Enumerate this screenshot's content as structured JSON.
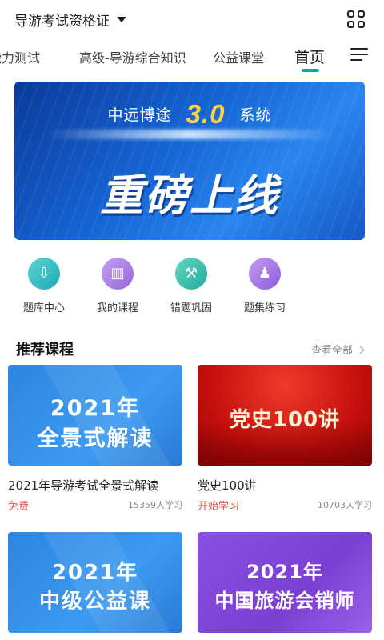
{
  "header": {
    "certificate": "导游考试资格证",
    "grid_icon": "grid-apps-icon",
    "caret_icon": "caret-down-icon"
  },
  "tabs": [
    {
      "label": "能力测试"
    },
    {
      "label": "高级-导游综合知识"
    },
    {
      "label": "公益课堂"
    },
    {
      "label": "首页",
      "active": true
    }
  ],
  "banner": {
    "line1_left": "中远博途",
    "version": "3.0",
    "line1_right": "系统",
    "headline": "重磅上线"
  },
  "quick_links": [
    {
      "label": "题库中心",
      "icon": "download-icon"
    },
    {
      "label": "我的课程",
      "icon": "book-icon"
    },
    {
      "label": "错题巩固",
      "icon": "tools-icon"
    },
    {
      "label": "题集练习",
      "icon": "users-icon"
    }
  ],
  "recommended": {
    "title": "推荐课程",
    "view_all": "查看全部"
  },
  "courses": [
    {
      "cover_line1": "2021年",
      "cover_line2": "全景式解读",
      "title": "2021年导游考试全景式解读",
      "tag": "免费",
      "count": "15359人学习"
    },
    {
      "cover_line1": "党史100讲",
      "title": "党史100讲",
      "tag": "开始学习",
      "count": "10703人学习"
    },
    {
      "cover_line1": "2021年",
      "cover_line2": "中级公益课"
    },
    {
      "cover_line1": "2021年",
      "cover_line2": "中国旅游会销师"
    }
  ],
  "colors": {
    "accent": "#1fa58a",
    "tag_red": "#e0524a"
  }
}
